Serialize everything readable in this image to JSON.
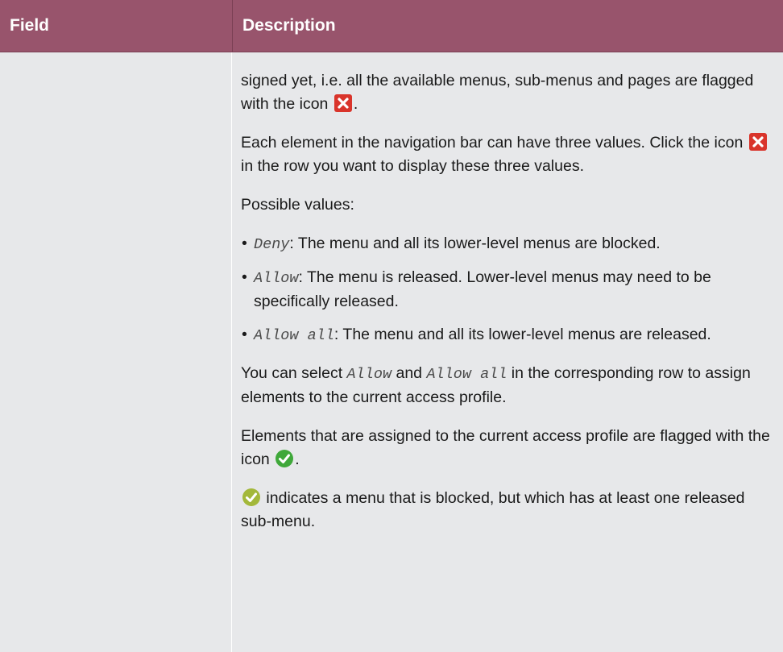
{
  "header": {
    "field": "Field",
    "description": "Description"
  },
  "description": {
    "p1": {
      "text": "signed yet, i.e. all the available menus, sub-menus and pages are flagged with the icon",
      "end": "."
    },
    "p2": {
      "before": "Each element in the navigation bar can have three values. Click the icon",
      "after": "in the row you want to display these three values."
    },
    "p3": "Possible values:",
    "values": [
      {
        "name": "Deny",
        "text": ": The menu and all its lower-level menus are blocked."
      },
      {
        "name": "Allow",
        "text": ": The menu is released. Lower-level menus may need to be specifically released."
      },
      {
        "name": "Allow all",
        "text": ": The menu and all its lower-level menus are released."
      }
    ],
    "p4": {
      "before": "You can select",
      "v1": "Allow",
      "and": "and",
      "v2": "Allow all",
      "after": "in the corresponding row to assign elements to the current access profile."
    },
    "p5": {
      "text": "Elements that are assigned to the current access profile are flagged with the icon",
      "end": "."
    },
    "p6": "indicates a menu that is blocked, but which has at least one released sub-menu."
  },
  "colors": {
    "header_bg": "#98546c",
    "body_bg": "#e7e8ea",
    "deny_icon": "#d9342b",
    "check_icon": "#3fa83a",
    "partial_icon": "#a3b83a"
  },
  "icons": [
    "red-x-icon",
    "green-check-icon",
    "yellow-green-check-icon"
  ]
}
